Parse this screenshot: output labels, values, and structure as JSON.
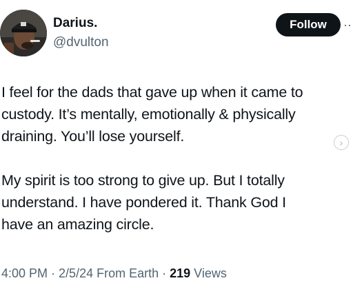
{
  "author": {
    "display_name": "Darius.",
    "handle": "@dvulton"
  },
  "follow_label": "Follow",
  "more_label": "···",
  "tweet": {
    "lines": [
      "I feel for the dads that gave up when it came to",
      "custody. It’s mentally, emotionally & physically",
      "draining. You’ll lose yourself.",
      "",
      "My spirit is too strong to give up. But I totally",
      "understand. I have pondered it. Thank God I",
      "have an amazing circle."
    ]
  },
  "meta": {
    "time": "4:00 PM",
    "separator": " · ",
    "date_source": "2/5/24 From Earth",
    "views_count": "219",
    "views_label": " Views"
  },
  "carousel_arrow": "›",
  "colors": {
    "text": "#0f1419",
    "secondary": "#536471",
    "button_bg": "#0f1419",
    "button_text": "#ffffff"
  },
  "icons": {
    "avatar": "profile-photo",
    "more": "more-icon",
    "carousel": "chevron-right-icon"
  }
}
